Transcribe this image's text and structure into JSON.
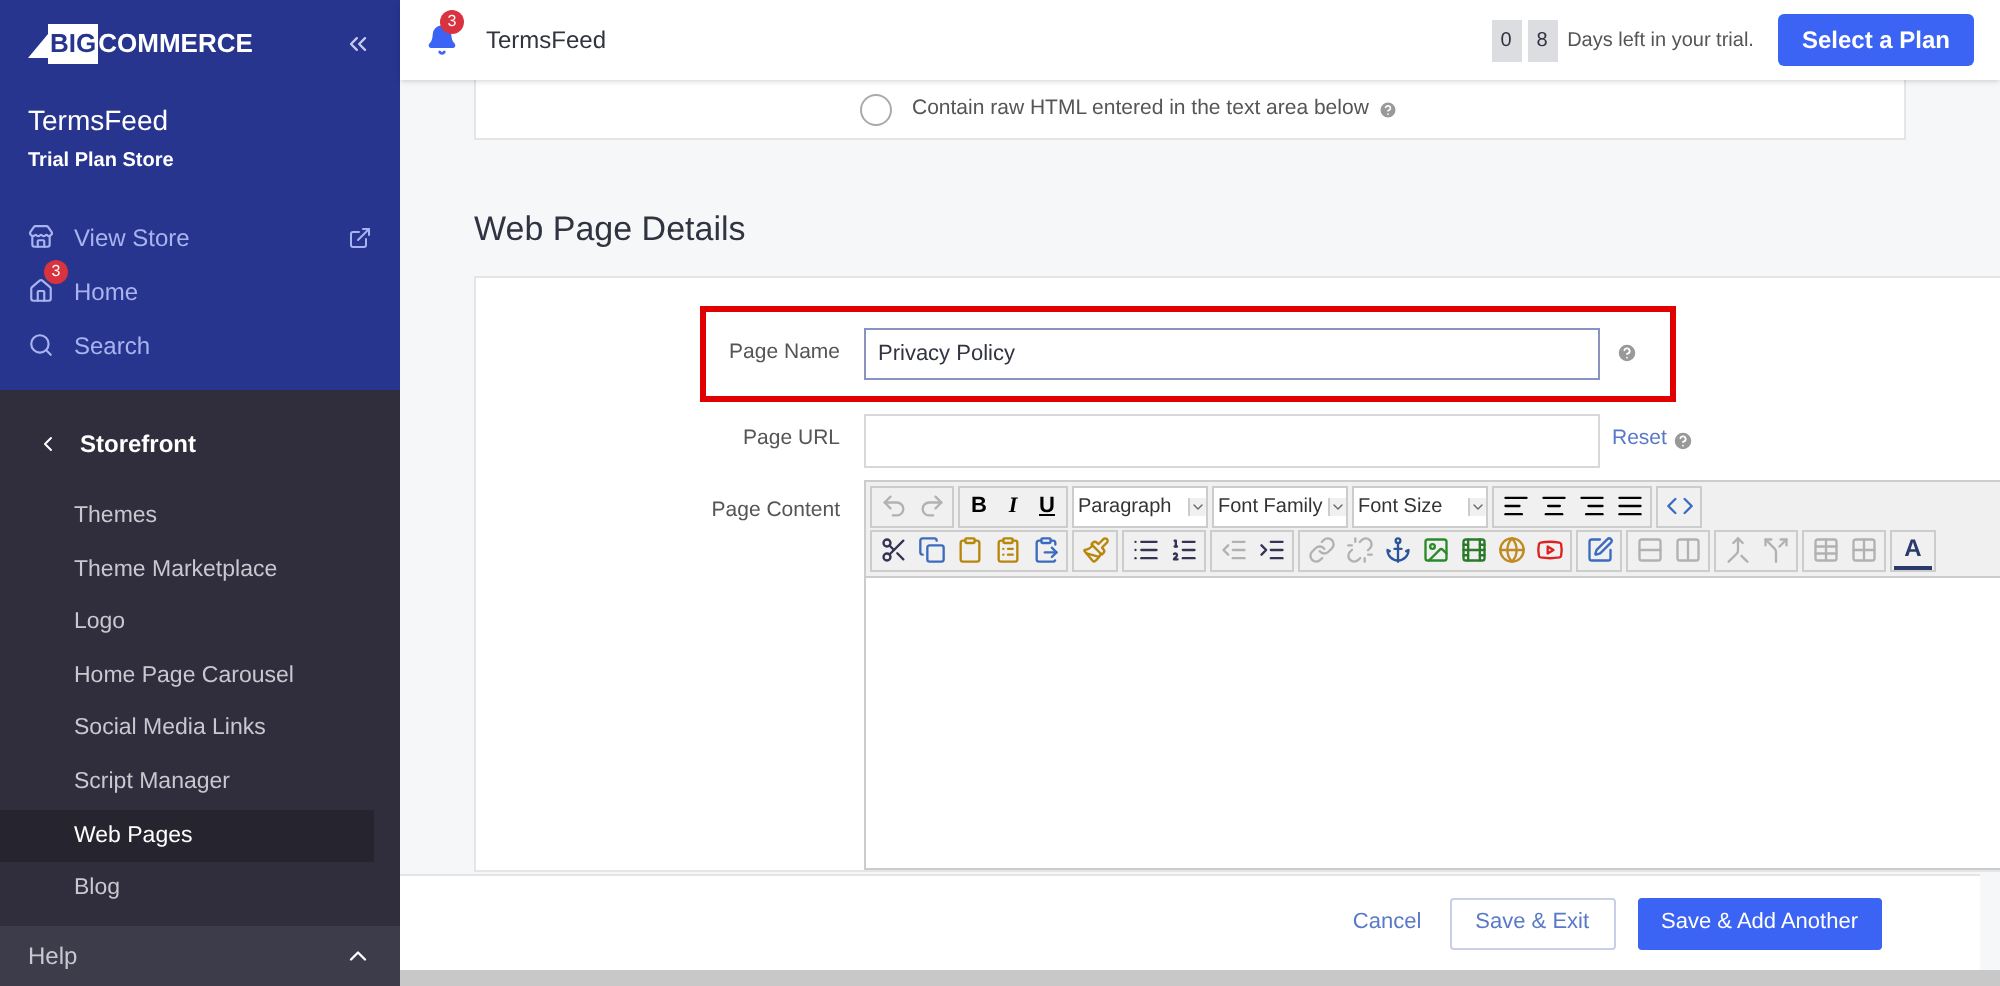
{
  "sidebar": {
    "logo": {
      "prefix": "BIG",
      "rest": "COMMERCE"
    },
    "store_name": "TermsFeed",
    "store_plan": "Trial Plan Store",
    "nav": [
      {
        "kind": "store",
        "label": "View Store"
      },
      {
        "kind": "home",
        "label": "Home",
        "badge": "3"
      },
      {
        "kind": "search",
        "label": "Search"
      }
    ],
    "section": "Storefront",
    "items": [
      {
        "label": "Themes",
        "selected": false
      },
      {
        "label": "Theme Marketplace",
        "selected": false
      },
      {
        "label": "Logo",
        "selected": false
      },
      {
        "label": "Home Page Carousel",
        "selected": false
      },
      {
        "label": "Social Media Links",
        "selected": false
      },
      {
        "label": "Script Manager",
        "selected": false
      },
      {
        "label": "Web Pages",
        "selected": true
      },
      {
        "label": "Blog",
        "selected": false
      }
    ],
    "help": "Help"
  },
  "header": {
    "notification_count": "3",
    "store": "TermsFeed",
    "trial_digits": [
      "0",
      "8"
    ],
    "trial_text": "Days left in your trial.",
    "plan_button": "Select a Plan"
  },
  "top_card": {
    "radio_label": "Contain raw HTML entered in the text area below",
    "checked": false
  },
  "section_title": "Web Page Details",
  "form": {
    "page_name": {
      "label": "Page Name",
      "value": "Privacy Policy",
      "highlighted": true
    },
    "page_url": {
      "label": "Page URL",
      "link": "Reset"
    },
    "content": {
      "label": "Page Content",
      "format_buttons": [
        "B",
        "I",
        "U"
      ],
      "selects": [
        "Paragraph",
        "Font Family",
        "Font Size"
      ],
      "text_color": "A"
    }
  },
  "footer": {
    "cancel": "Cancel",
    "save_exit": "Save & Exit",
    "save_add": "Save & Add Another"
  }
}
